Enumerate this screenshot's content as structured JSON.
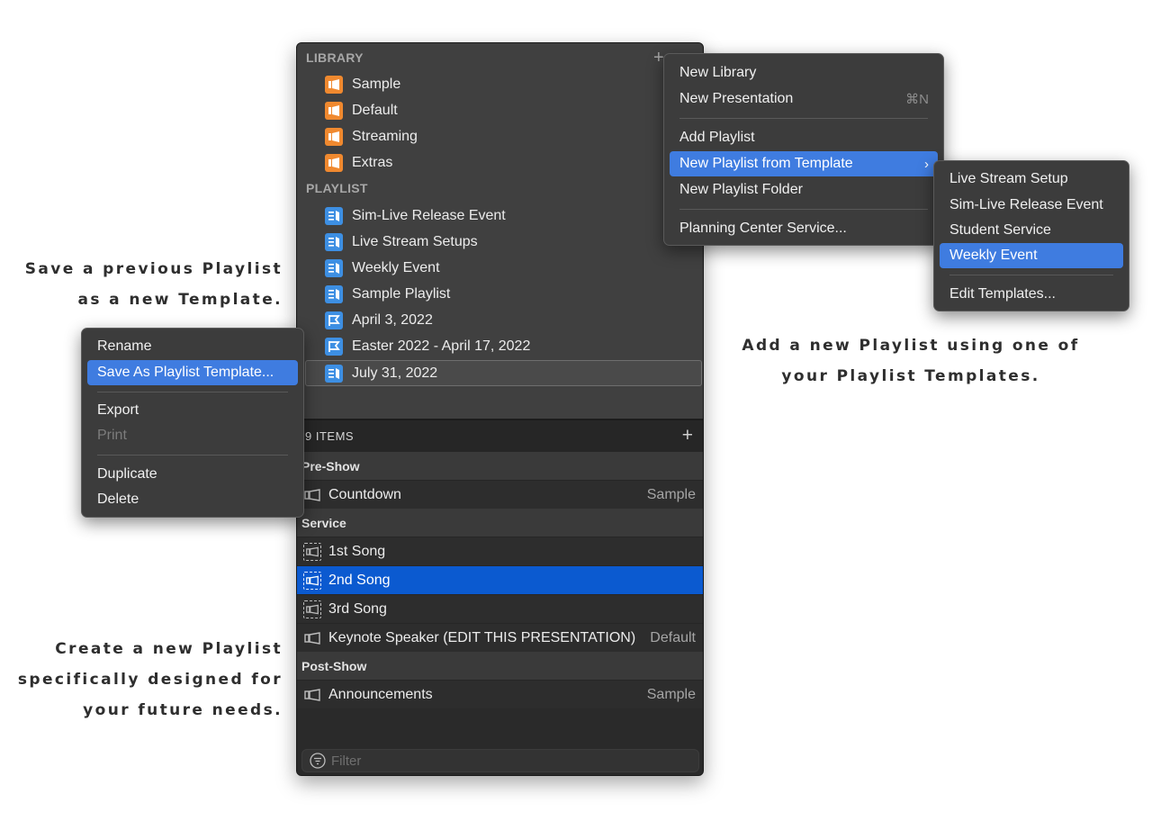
{
  "callouts": {
    "left_top": [
      "Save a previous Playlist",
      "as a new Template."
    ],
    "left_bottom": [
      "Create a new Playlist",
      "specifically designed for",
      "your future needs."
    ],
    "right": [
      "Add a new Playlist using one of",
      "your Playlist Templates."
    ]
  },
  "library": {
    "section_label": "LIBRARY",
    "add_symbol": "+",
    "items": [
      "Sample",
      "Default",
      "Streaming",
      "Extras"
    ]
  },
  "playlist": {
    "section_label": "PLAYLIST",
    "items": [
      {
        "label": "Sim-Live Release Event",
        "icon": "playlist-template-icon"
      },
      {
        "label": "Live Stream Setups",
        "icon": "playlist-template-icon"
      },
      {
        "label": "Weekly Event",
        "icon": "playlist-template-icon"
      },
      {
        "label": "Sample Playlist",
        "icon": "playlist-template-icon"
      },
      {
        "label": "April 3, 2022",
        "icon": "planning-center-icon"
      },
      {
        "label": "Easter 2022 - April 17, 2022",
        "icon": "planning-center-icon"
      },
      {
        "label": "July 31, 2022",
        "icon": "playlist-template-icon"
      }
    ]
  },
  "items_panel": {
    "count_label": "9 ITEMS",
    "add_symbol": "+",
    "groups": {
      "pre_show": "Pre-Show",
      "service": "Service",
      "post_show": "Post-Show"
    },
    "rows": [
      {
        "name": "Countdown",
        "library": "Sample"
      },
      {
        "name": "1st Song",
        "library": ""
      },
      {
        "name": "2nd Song",
        "library": ""
      },
      {
        "name": "3rd Song",
        "library": ""
      },
      {
        "name": "Keynote Speaker (EDIT THIS PRESENTATION)",
        "library": "Default"
      },
      {
        "name": "Announcements",
        "library": "Sample"
      }
    ],
    "filter_placeholder": "Filter"
  },
  "context_menu": {
    "items": [
      "Rename",
      "Save As Playlist Template...",
      "Export",
      "Print",
      "Duplicate",
      "Delete"
    ]
  },
  "add_menu": {
    "items": [
      "New Library",
      "New Presentation",
      "Add Playlist",
      "New Playlist from Template",
      "New Playlist Folder",
      "Planning Center Service..."
    ],
    "shortcut": "⌘N",
    "submenu_arrow": "›"
  },
  "template_submenu": {
    "items": [
      "Live Stream Setup",
      "Sim-Live Release Event",
      "Student Service",
      "Weekly Event",
      "Edit Templates..."
    ]
  },
  "colors": {
    "highlight": "#3f7ce0",
    "selection": "#0b5ad0",
    "library_icon": "#f0892f",
    "playlist_icon": "#3d8fe3"
  }
}
